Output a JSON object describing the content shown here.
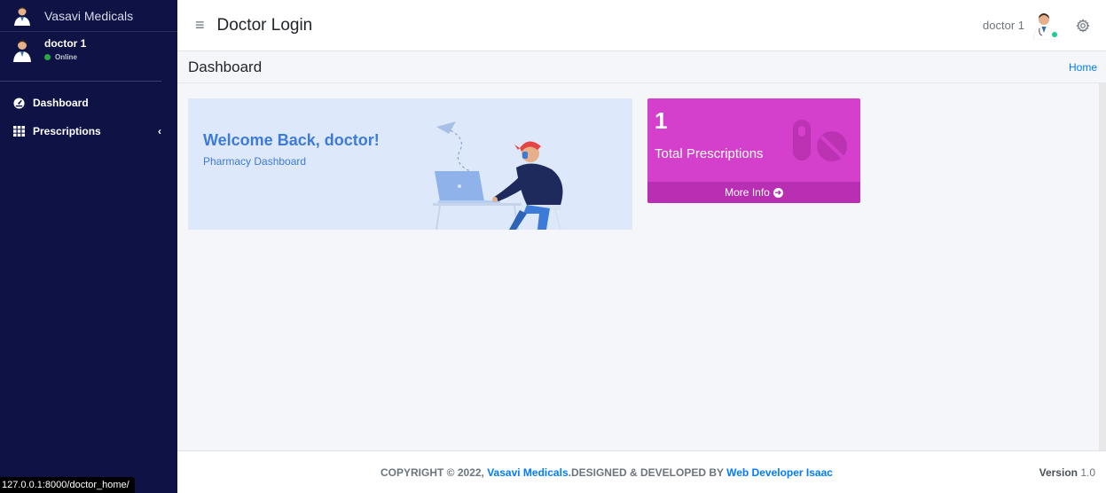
{
  "sidebar": {
    "brand": "Vasavi Medicals",
    "user": {
      "name": "doctor 1",
      "status": "Online"
    },
    "items": [
      {
        "label": "Dashboard",
        "icon": "tachometer-icon"
      },
      {
        "label": "Prescriptions",
        "icon": "grid-icon",
        "chevron": "‹"
      }
    ]
  },
  "topbar": {
    "title": "Doctor Login",
    "hamburger": "≡",
    "username": "doctor 1",
    "icons": [
      "menu-icon",
      "avatar",
      "gear-icon"
    ]
  },
  "content_header": {
    "title": "Dashboard",
    "breadcrumb": "Home"
  },
  "welcome": {
    "title": "Welcome Back, doctor!",
    "subtitle": "Pharmacy Dashboard"
  },
  "info_box": {
    "count": "1",
    "label": "Total Prescriptions",
    "footer": "More Info",
    "arrow": "➜",
    "icon": "pills-icon",
    "color": "#d43fcc"
  },
  "footer": {
    "copyright_prefix": "COPYRIGHT © 2022, ",
    "brand_link": "Vasavi Medicals",
    "middle": ".DESIGNED & DEVELOPED BY ",
    "dev_link": "Web Developer Isaac",
    "version_label": "Version",
    "version_value": " 1.0"
  },
  "status_url": "127.0.0.1:8000/doctor_home/",
  "colors": {
    "sidebar_bg": "#0e1245",
    "accent": "#007bff",
    "online": "#28a745"
  }
}
